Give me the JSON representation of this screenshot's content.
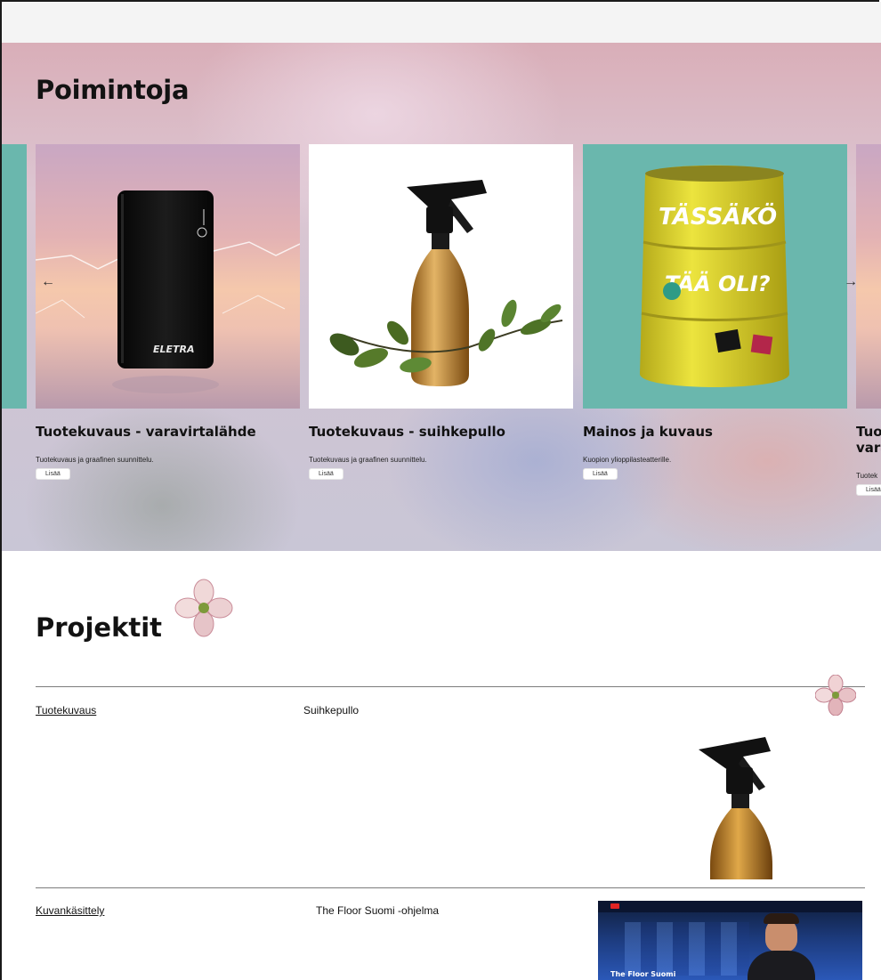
{
  "hero": {
    "title": "Poimintoja",
    "prev_arrow": "←",
    "next_arrow": "→",
    "cards": [
      {
        "title": "Tuotekuvaus - varavirtalähde",
        "description": "Tuotekuvaus ja graafinen suunnittelu.",
        "button": "Lisää",
        "image_text": "ELETRA"
      },
      {
        "title": "Tuotekuvaus - suihkepullo",
        "description": "Tuotekuvaus ja graafinen suunnittelu.",
        "button": "Lisää"
      },
      {
        "title": "Mainos ja kuvaus",
        "description": "Kuopion ylioppilasteatterille.",
        "button": "Lisää",
        "image_text": [
          "TÄSSÄKÖ",
          "TÄÄ OLI?"
        ]
      },
      {
        "title": "Tuo vara",
        "description": "Tuotek",
        "button": "Lisää"
      }
    ]
  },
  "projects": {
    "title": "Projektit",
    "rows": [
      {
        "category": "Tuotekuvaus",
        "name": "Suihkepullo"
      },
      {
        "category": "Kuvankäsittely",
        "name": "The Floor Suomi -ohjelma",
        "thumb_title": "The Floor Suomi"
      }
    ]
  },
  "colors": {
    "teal": "#6ab7ad",
    "barrel_yellow": "#e4dc35",
    "amber_bottle": "#c8892e"
  },
  "icons": [
    "arrow-left-icon",
    "arrow-right-icon",
    "flower-icon"
  ]
}
